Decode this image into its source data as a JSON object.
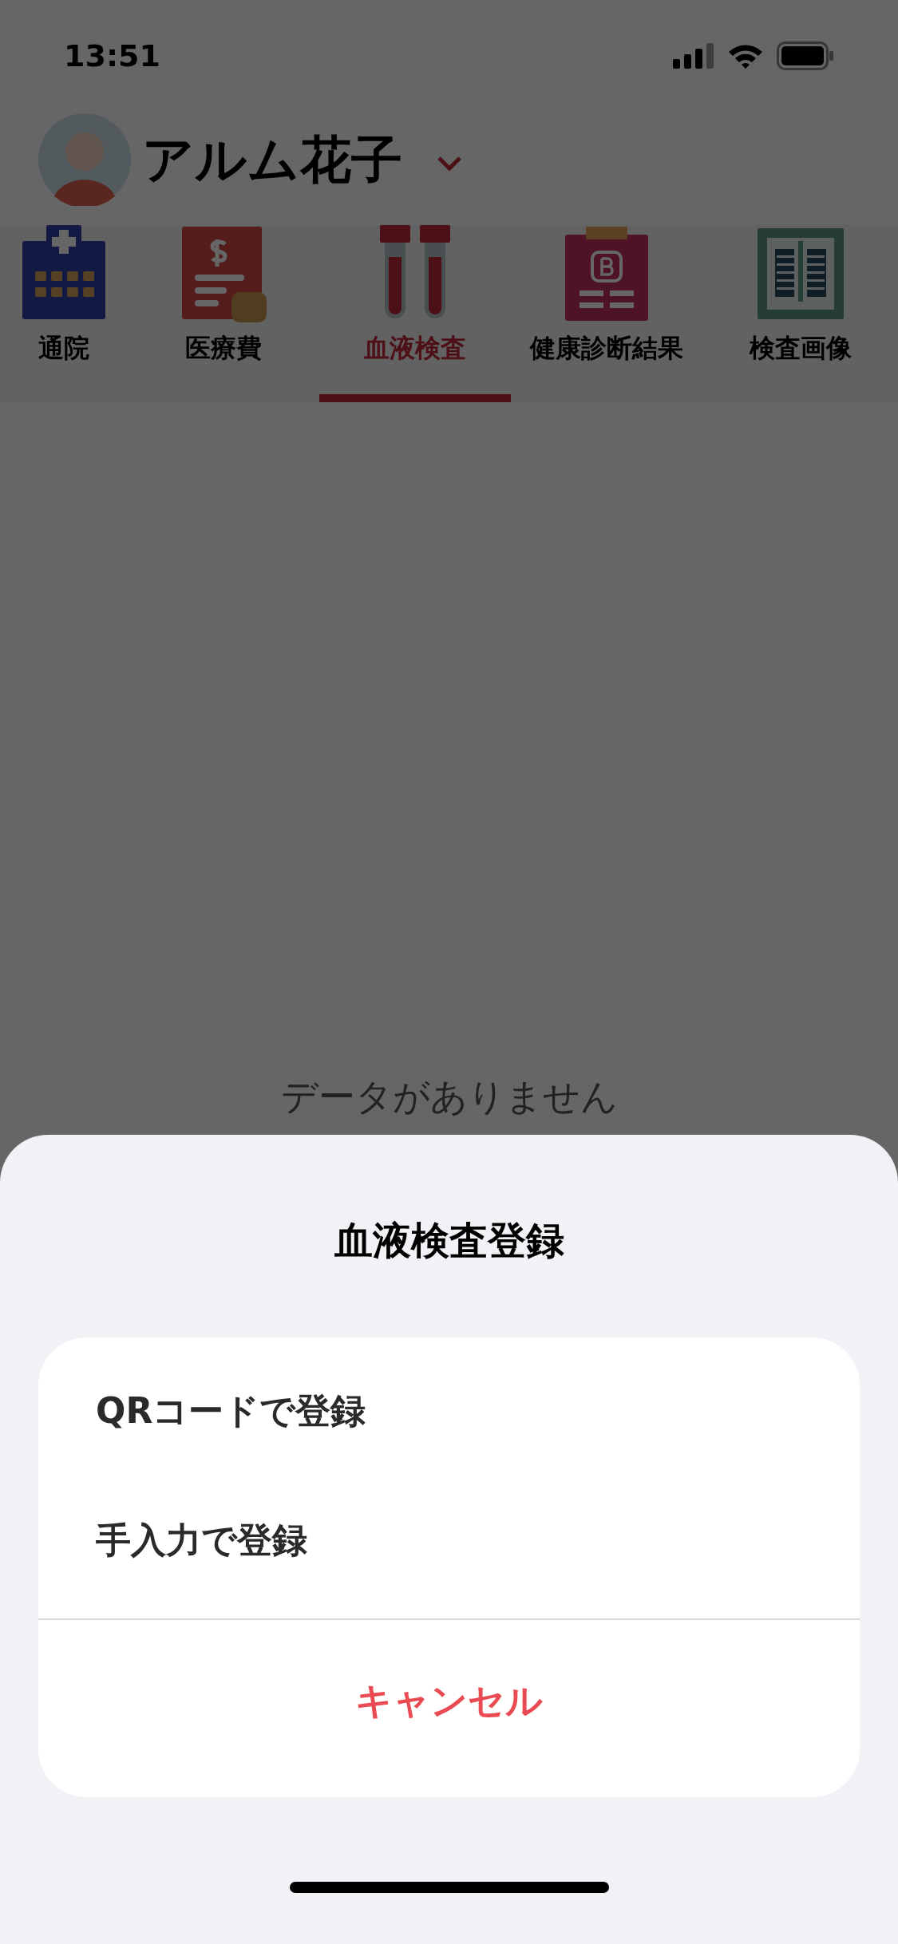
{
  "status_bar": {
    "time": "13:51"
  },
  "profile": {
    "name": "アルム花子"
  },
  "tabs": [
    {
      "label": "通院",
      "selected": false
    },
    {
      "label": "医療費",
      "selected": false
    },
    {
      "label": "血液検査",
      "selected": true
    },
    {
      "label": "健康診断結果",
      "selected": false
    },
    {
      "label": "検査画像",
      "selected": false
    }
  ],
  "empty_message": "データがありません",
  "sheet": {
    "title": "血液検査登録",
    "options": [
      "QRコードで登録",
      "手入力で登録"
    ],
    "cancel": "キャンセル"
  }
}
